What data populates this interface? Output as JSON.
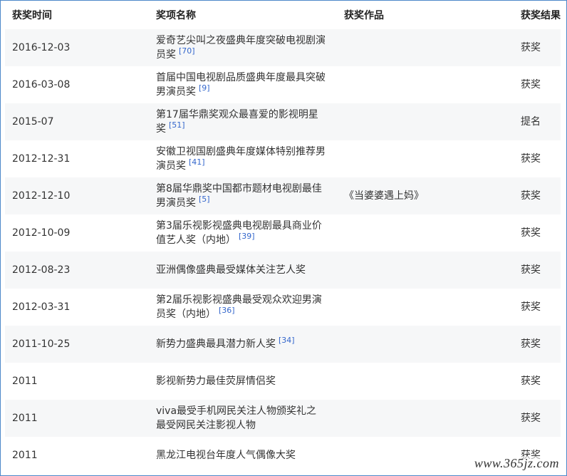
{
  "table": {
    "headers": {
      "time": "获奖时间",
      "award": "奖项名称",
      "work": "获奖作品",
      "result": "获奖结果"
    },
    "rows": [
      {
        "time": "2016-12-03",
        "award": "爱奇艺尖叫之夜盛典年度突破电视剧演员奖",
        "ref": "[70]",
        "work": "",
        "result": "获奖"
      },
      {
        "time": "2016-03-08",
        "award": "首届中国电视剧品质盛典年度最具突破男演员奖",
        "ref": "[9]",
        "work": "",
        "result": "获奖"
      },
      {
        "time": "2015-07",
        "award": "第17届华鼎奖观众最喜爱的影视明星奖",
        "ref": "[51]",
        "work": "",
        "result": "提名"
      },
      {
        "time": "2012-12-31",
        "award": "安徽卫视国剧盛典年度媒体特别推荐男演员奖",
        "ref": "[41]",
        "work": "",
        "result": "获奖"
      },
      {
        "time": "2012-12-10",
        "award": "第8届华鼎奖中国都市题材电视剧最佳男演员奖",
        "ref": "[5]",
        "work": "《当婆婆遇上妈》",
        "result": "获奖"
      },
      {
        "time": "2012-10-09",
        "award": "第3届乐视影视盛典电视剧最具商业价值艺人奖（内地）",
        "ref": "[39]",
        "work": "",
        "result": "获奖"
      },
      {
        "time": "2012-08-23",
        "award": "亚洲偶像盛典最受媒体关注艺人奖",
        "ref": "",
        "work": "",
        "result": "获奖"
      },
      {
        "time": "2012-03-31",
        "award": "第2届乐视影视盛典最受观众欢迎男演员奖（内地）",
        "ref": "[36]",
        "work": "",
        "result": "获奖"
      },
      {
        "time": "2011-10-25",
        "award": "新势力盛典最具潜力新人奖",
        "ref": "[34]",
        "work": "",
        "result": "获奖"
      },
      {
        "time": "2011",
        "award": "影视新势力最佳荧屏情侣奖",
        "ref": "",
        "work": "",
        "result": "获奖"
      },
      {
        "time": "2011",
        "award": "viva最受手机网民关注人物颁奖礼之最受网民关注影视人物",
        "ref": "",
        "work": "",
        "result": "获奖"
      },
      {
        "time": "2011",
        "award": "黑龙江电视台年度人气偶像大奖",
        "ref": "",
        "work": "",
        "result": "获奖"
      }
    ]
  },
  "watermark": "www.365jz.com"
}
